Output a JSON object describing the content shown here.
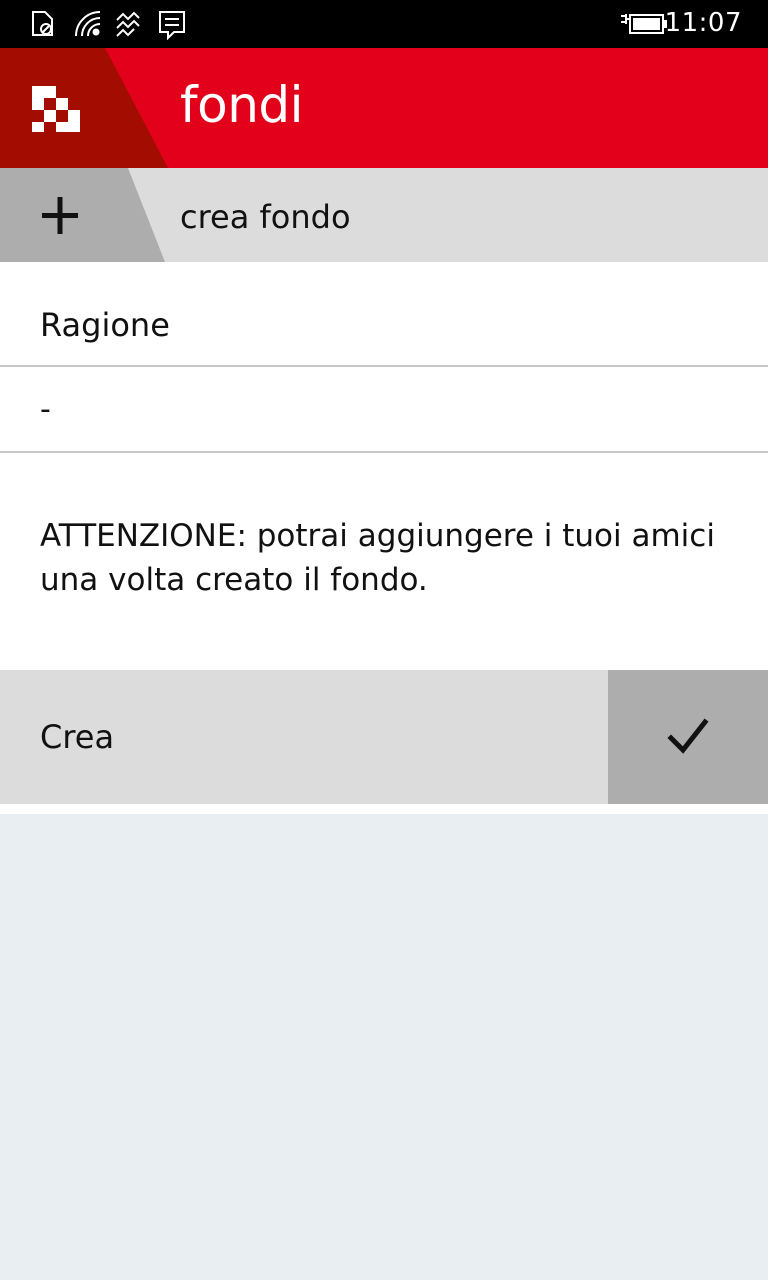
{
  "status_bar": {
    "time": "11:07",
    "icons": [
      "no-sim-icon",
      "wifi-icon",
      "data-icon",
      "notification-icon",
      "battery-charging-icon"
    ]
  },
  "header": {
    "title": "fondi",
    "logo_icon": "checkered-logo-icon",
    "colors": {
      "primary": "#e2001a",
      "dark": "#a30c00"
    }
  },
  "create_bar": {
    "icon": "plus-icon",
    "label": "crea fondo"
  },
  "form": {
    "reason_label": "Ragione",
    "reason_value": "-",
    "notice": "ATTENZIONE: potrai aggiungere i tuoi amici una volta creato il fondo."
  },
  "action_bar": {
    "label": "Crea",
    "icon": "checkmark-icon"
  }
}
